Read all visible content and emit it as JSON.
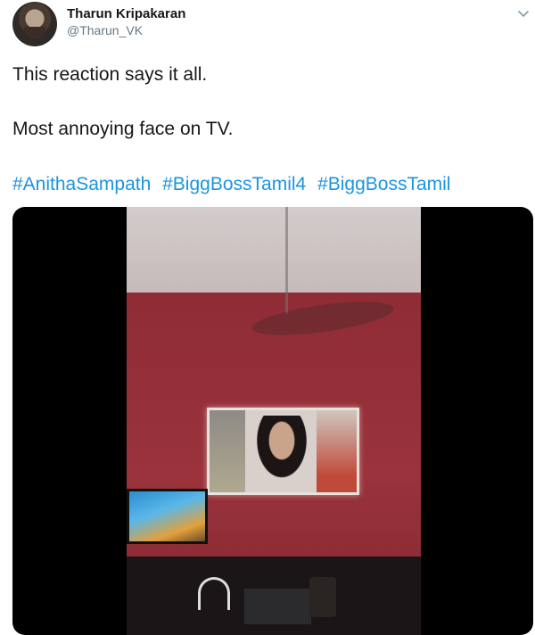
{
  "tweet": {
    "author_name": "Tharun Kripakaran",
    "author_handle": "@Tharun_VK",
    "text_line_1": "This reaction says it all.",
    "text_line_2": "Most annoying face on TV.",
    "hashtags": [
      "#AnithaSampath",
      "#BiggBossTamil4",
      "#BiggBossTamil"
    ]
  },
  "icons": {
    "menu": "chevron-down-icon",
    "avatar": "avatar"
  },
  "colors": {
    "link": "#1b95e0",
    "text": "#14171a",
    "secondary": "#657786"
  }
}
